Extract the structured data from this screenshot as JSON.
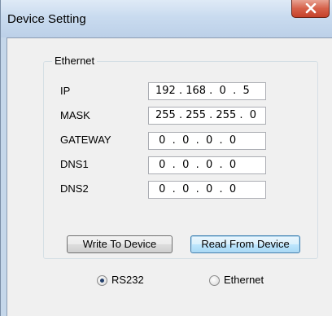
{
  "window": {
    "title": "Device Setting",
    "close_glyph": "x"
  },
  "ethernet_group": {
    "label": "Ethernet",
    "fields": [
      {
        "label": "IP",
        "value": "192 . 168 .  0  .  5"
      },
      {
        "label": "MASK",
        "value": "255 . 255 . 255 .  0"
      },
      {
        "label": "GATEWAY",
        "value": " 0  .  0  .  0  .  0"
      },
      {
        "label": "DNS1",
        "value": " 0  .  0  .  0  .  0"
      },
      {
        "label": "DNS2",
        "value": " 0  .  0  .  0  .  0"
      }
    ],
    "write_button": "Write To Device",
    "read_button": "Read From Device"
  },
  "connection": {
    "options": [
      {
        "label": "RS232",
        "selected": true
      },
      {
        "label": "Ethernet",
        "selected": false
      }
    ]
  }
}
